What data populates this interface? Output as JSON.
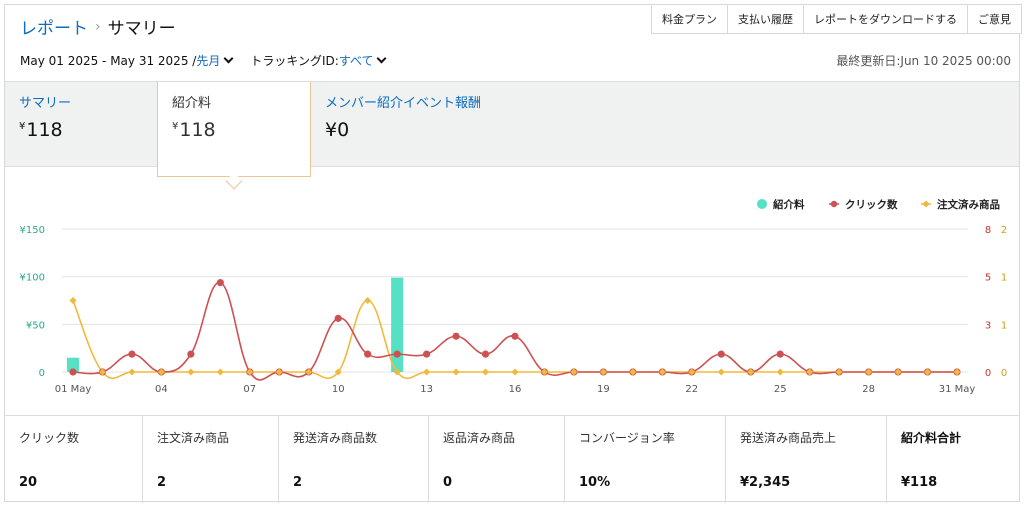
{
  "breadcrumb": {
    "parent": "レポート",
    "separator": "›",
    "current": "サマリー"
  },
  "top_buttons": [
    "料金プラン",
    "支払い履歴",
    "レポートをダウンロードする",
    "ご意見"
  ],
  "filters": {
    "date_range": "May 01 2025 - May 31 2025 /",
    "period_link": "先月",
    "tracking_label": "トラッキングID:",
    "tracking_link": "すべて"
  },
  "last_updated": "最終更新日:Jun 10 2025 00:00",
  "summary_cards": [
    {
      "label": "サマリー",
      "currency": "¥",
      "value": "118"
    },
    {
      "label": "紹介料",
      "currency": "¥",
      "value": "118"
    },
    {
      "label": "メンバー紹介イベント報酬",
      "currency": "",
      "value": "¥0"
    }
  ],
  "colors": {
    "fees": "#56e0c4",
    "clicks": "#cd5153",
    "ordered": "#f0b93c",
    "link": "#0f6cbf"
  },
  "chart_data": {
    "type": "bar+line",
    "legend": [
      "紹介料",
      "クリック数",
      "注文済み商品"
    ],
    "legend_position": "top-right",
    "x_ticks": [
      "01 May",
      "04",
      "07",
      "10",
      "13",
      "16",
      "19",
      "22",
      "25",
      "28",
      "31 May"
    ],
    "x": [
      1,
      2,
      3,
      4,
      5,
      6,
      7,
      8,
      9,
      10,
      11,
      12,
      13,
      14,
      15,
      16,
      17,
      18,
      19,
      20,
      21,
      22,
      23,
      24,
      25,
      26,
      27,
      28,
      29,
      30,
      31
    ],
    "y_left_ticks": [
      "¥150",
      "¥100",
      "¥50",
      "0"
    ],
    "y_clicks_ticks": [
      "8",
      "5",
      "3",
      "0"
    ],
    "y_ordered_ticks": [
      "2",
      "1",
      "1",
      "0"
    ],
    "ylim_fees": [
      0,
      150
    ],
    "ylim_clicks": [
      0,
      8
    ],
    "ylim_ordered": [
      0,
      2
    ],
    "grid": true,
    "series": [
      {
        "name": "紹介料",
        "type": "bar",
        "values": [
          15,
          0,
          0,
          0,
          0,
          0,
          0,
          0,
          0,
          0,
          0,
          99,
          0,
          0,
          0,
          0,
          0,
          0,
          0,
          0,
          0,
          0,
          0,
          0,
          0,
          0,
          0,
          0,
          0,
          0,
          0
        ]
      },
      {
        "name": "クリック数",
        "type": "line",
        "values": [
          0,
          0,
          1,
          0,
          1,
          5,
          0,
          0,
          0,
          3,
          1,
          1,
          1,
          2,
          1,
          2,
          0,
          0,
          0,
          0,
          0,
          0,
          1,
          0,
          1,
          0,
          0,
          0,
          0,
          0,
          0
        ]
      },
      {
        "name": "注文済み商品",
        "type": "line",
        "values": [
          1,
          0,
          0,
          0,
          0,
          0,
          0,
          0,
          0,
          0,
          1,
          0,
          0,
          0,
          0,
          0,
          0,
          0,
          0,
          0,
          0,
          0,
          0,
          0,
          0,
          0,
          0,
          0,
          0,
          0,
          0
        ]
      }
    ]
  },
  "stats": [
    {
      "label": "クリック数",
      "value": "20"
    },
    {
      "label": "注文済み商品",
      "value": "2"
    },
    {
      "label": "発送済み商品数",
      "value": "2"
    },
    {
      "label": "返品済み商品",
      "value": "0"
    },
    {
      "label": "コンバージョン率",
      "value": "10%"
    },
    {
      "label": "発送済み商品売上",
      "value": "¥2,345"
    },
    {
      "label": "紹介料合計",
      "value": "¥118"
    }
  ]
}
